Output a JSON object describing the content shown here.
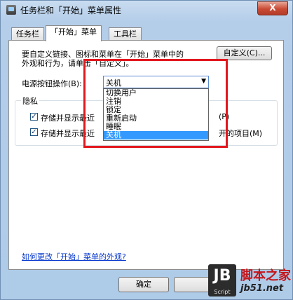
{
  "window": {
    "title": "任务栏和「开始」菜单属性",
    "close_label": "X"
  },
  "tabs": [
    {
      "label": "任务栏"
    },
    {
      "label": "「开始」菜单"
    },
    {
      "label": "工具栏"
    }
  ],
  "panel": {
    "desc_line1": "要自定义链接、图标和菜单在「开始」菜单中的",
    "desc_line2": "外观和行为，请单击「自定义」。",
    "customize_button": "自定义(C)...",
    "power_label": "电源按钮操作(B):",
    "power_select": {
      "value": "关机"
    },
    "power_options": [
      "切换用户",
      "注销",
      "锁定",
      "重新启动",
      "睡眠",
      "关机"
    ],
    "privacy": {
      "label": "隐私",
      "item1_left": "存储并显示最近",
      "item1_right": "(P)",
      "item2_left": "存储并显示最近",
      "item2_right": "开的项目(M)"
    },
    "help_link": "如何更改「开始」菜单的外观?"
  },
  "footer": {
    "ok_button": "确定"
  },
  "watermark": {
    "logo": "JB",
    "logo_sub": "Script",
    "cn_text": "脚本之家",
    "url": "jb51.net"
  },
  "colors": {
    "highlight": "#e3171e",
    "selection": "#3399ff",
    "link": "#0033cc"
  }
}
